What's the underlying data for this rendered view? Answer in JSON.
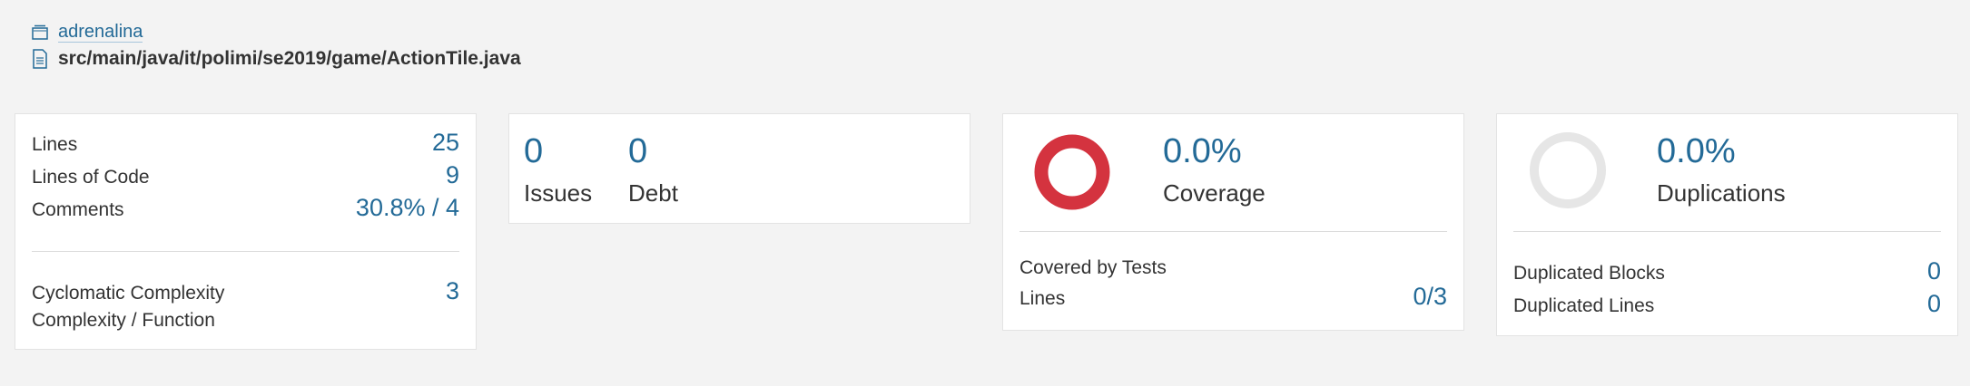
{
  "header": {
    "project": "adrenalina",
    "file_path": "src/main/java/it/polimi/se2019/game/ActionTile.java"
  },
  "size_card": {
    "lines_label": "Lines",
    "lines_value": "25",
    "loc_label": "Lines of Code",
    "loc_value": "9",
    "comments_label": "Comments",
    "comments_value": "30.8% / 4",
    "cc_label": "Cyclomatic Complexity",
    "cc_value": "3",
    "cf_label": "Complexity / Function"
  },
  "issues_card": {
    "issues_value": "0",
    "issues_label": "Issues",
    "debt_value": "0",
    "debt_label": "Debt"
  },
  "coverage_card": {
    "value": "0.0%",
    "label": "Coverage",
    "covered_label": "Covered by Tests",
    "lines_label": "Lines",
    "lines_value": "0/3",
    "donut_color": "#d4333f",
    "coverage_fraction": 0.0
  },
  "duplications_card": {
    "value": "0.0%",
    "label": "Duplications",
    "blocks_label": "Duplicated Blocks",
    "blocks_value": "0",
    "lines_label": "Duplicated Lines",
    "lines_value": "0",
    "donut_color": "#e6e6e6"
  },
  "colors": {
    "accent": "#236a97",
    "background": "#f3f3f3"
  }
}
